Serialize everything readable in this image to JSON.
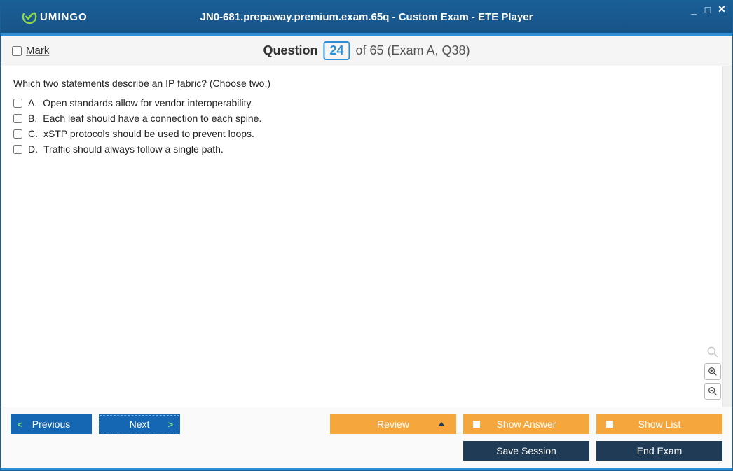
{
  "window": {
    "logo_text": "UMINGO",
    "title": "JN0-681.prepaway.premium.exam.65q - Custom Exam - ETE Player"
  },
  "header": {
    "mark_label": "Mark",
    "question_label": "Question",
    "current": "24",
    "of_text": "of 65 (Exam A, Q38)"
  },
  "question": {
    "stem": "Which two statements describe an IP fabric? (Choose two.)",
    "choices": [
      {
        "letter": "A.",
        "text": "Open standards allow for vendor interoperability."
      },
      {
        "letter": "B.",
        "text": "Each leaf should have a connection to each spine."
      },
      {
        "letter": "C.",
        "text": "xSTP protocols should be used to prevent loops."
      },
      {
        "letter": "D.",
        "text": "Traffic should always follow a single path."
      }
    ]
  },
  "footer": {
    "previous": "Previous",
    "next": "Next",
    "review": "Review",
    "show_answer": "Show Answer",
    "show_list": "Show List",
    "save_session": "Save Session",
    "end_exam": "End Exam"
  }
}
